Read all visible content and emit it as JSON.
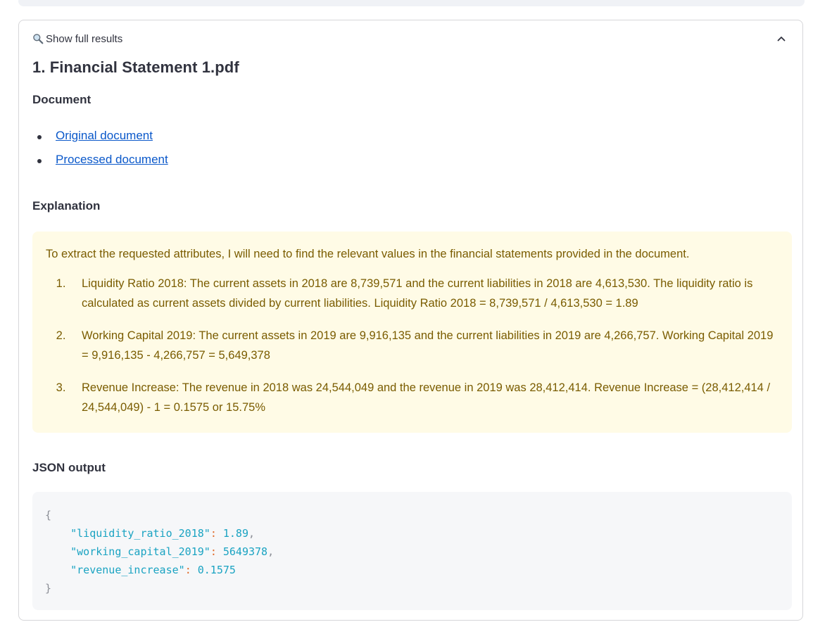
{
  "expander": {
    "title": "Show full results",
    "icon": "magnifier-icon",
    "toggle_icon": "chevron-up-icon"
  },
  "document": {
    "title": "1. Financial Statement 1.pdf",
    "section_label": "Document",
    "links": [
      {
        "label": "Original document"
      },
      {
        "label": "Processed document"
      }
    ]
  },
  "explanation": {
    "section_label": "Explanation",
    "intro": "To extract the requested attributes, I will need to find the relevant values in the financial statements provided in the document.",
    "items": [
      "Liquidity Ratio 2018: The current assets in 2018 are 8,739,571 and the current liabilities in 2018 are 4,613,530. The liquidity ratio is calculated as current assets divided by current liabilities. Liquidity Ratio 2018 = 8,739,571 / 4,613,530 = 1.89",
      "Working Capital 2019: The current assets in 2019 are 9,916,135 and the current liabilities in 2019 are 4,266,757. Working Capital 2019 = 9,916,135 - 4,266,757 = 5,649,378",
      "Revenue Increase: The revenue in 2018 was 24,544,049 and the revenue in 2019 was 28,412,414. Revenue Increase = (28,412,414 / 24,544,049) - 1 = 0.1575 or 15.75%"
    ]
  },
  "json_output": {
    "section_label": "JSON output",
    "open_brace": "{",
    "close_brace": "}",
    "entries": [
      {
        "key": "\"liquidity_ratio_2018\"",
        "value": "1.89",
        "comma": ","
      },
      {
        "key": "\"working_capital_2019\"",
        "value": "5649378",
        "comma": ","
      },
      {
        "key": "\"revenue_increase\"",
        "value": "0.1575",
        "comma": ""
      }
    ]
  },
  "colors": {
    "link": "#0a58ca",
    "explanation_bg": "#fffbe6",
    "explanation_text": "#7a5c00",
    "code_bg": "#f6f7f9",
    "code_key": "#1aa3c2"
  }
}
